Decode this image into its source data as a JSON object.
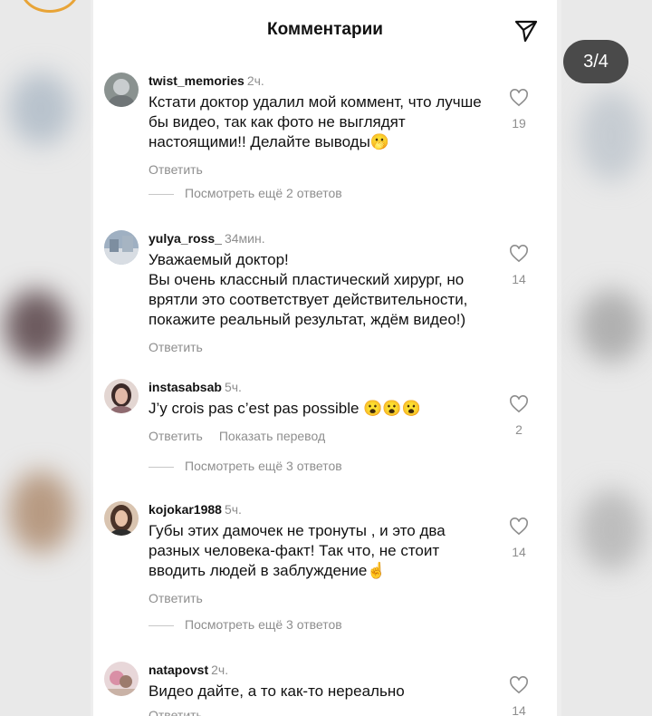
{
  "header": {
    "title": "Комментарии"
  },
  "overlay": {
    "page_counter": "3/4"
  },
  "colors": {
    "accent_story_ring": "#e8a437",
    "muted_text": "#8e8e8e"
  },
  "comments": [
    {
      "username": "twist_memories",
      "time": "2ч.",
      "text": "Кстати доктор удалил мой коммент, что лучше бы видео, так как фото не выглядят настоящими!! Делайте выводы",
      "emoji": "🫢",
      "likes": "19",
      "reply_label": "Ответить",
      "view_replies": "Посмотреть ещё 2 ответов"
    },
    {
      "username": "yulya_ross_",
      "time": "34мин.",
      "text": "Уважаемый доктор!\nВы очень классный пластический хирург, но врятли это соответствует  действительности, покажите реальный результат, ждём видео!)",
      "emoji": "",
      "likes": "14",
      "reply_label": "Ответить",
      "view_replies": ""
    },
    {
      "username": "instasabsab",
      "time": "5ч.",
      "text": "J’y crois pas c’est pas possible",
      "emoji": "😮😮😮",
      "likes": "2",
      "reply_label": "Ответить",
      "translate_label": "Показать перевод",
      "view_replies": "Посмотреть ещё 3 ответов"
    },
    {
      "username": "kojokar1988",
      "time": "5ч.",
      "text": "Губы этих дамочек не тронуты , и это два разных человека-факт! Так что, не стоит вводить людей в заблуждение",
      "emoji": "☝️",
      "likes": "14",
      "reply_label": "Ответить",
      "view_replies": "Посмотреть ещё 3 ответов"
    },
    {
      "username": "natapovst",
      "time": "2ч.",
      "text": "Видео дайте, а то как-то нереально",
      "emoji": "",
      "likes": "14",
      "reply_label": "Ответить",
      "view_replies": ""
    }
  ]
}
